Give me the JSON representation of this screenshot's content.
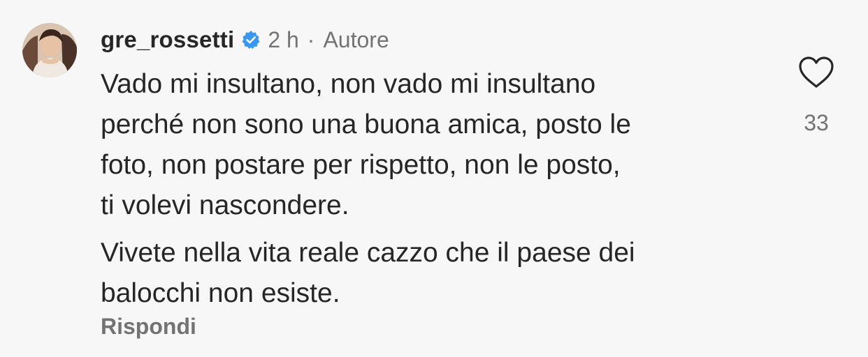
{
  "comment": {
    "username": "gre_rossetti",
    "verified": true,
    "time": "2 h",
    "separator": "·",
    "author_tag": "Autore",
    "paragraphs": [
      "Vado mi insultano, non vado mi insultano\nperché non sono una buona amica, posto le\nfoto, non postare per rispetto, non le posto,\nti volevi nascondere.",
      "Vivete nella vita reale cazzo che il paese dei\nbalocchi non esiste."
    ],
    "reply_label": "Rispondi",
    "like_count": "33"
  },
  "icons": {
    "avatar": "profile-avatar",
    "verified": "verified-badge-icon",
    "like": "heart-outline-icon"
  },
  "colors": {
    "background": "#f7f7f7",
    "text": "#262626",
    "secondary_text": "#737373",
    "verified_blue": "#3897f0"
  }
}
